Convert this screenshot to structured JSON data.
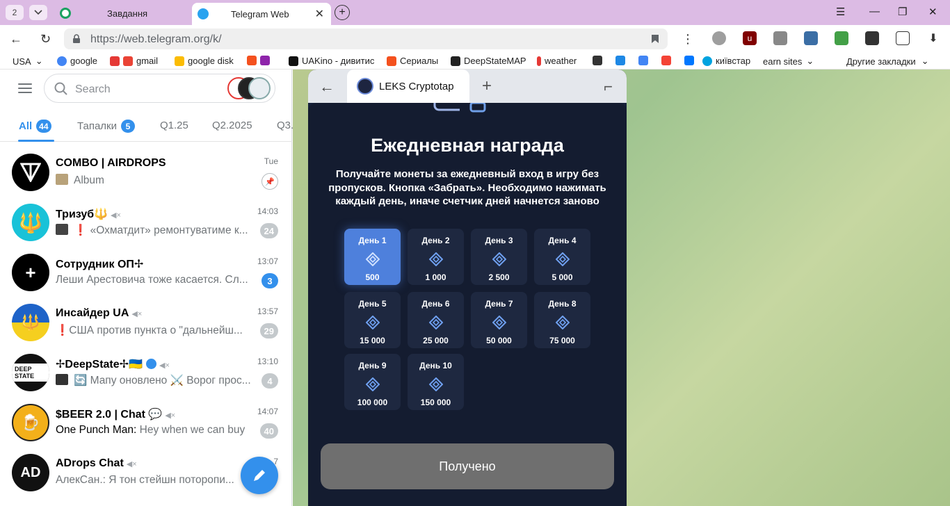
{
  "browser": {
    "tab_count": "2",
    "tabs": [
      {
        "title": "Завдання"
      },
      {
        "title": "Telegram Web"
      }
    ],
    "url": "https://web.telegram.org/k/",
    "bookmarks": [
      "USA",
      "google",
      "gmail",
      "google disk",
      "UAKino - дивитис",
      "Сериалы",
      "DeepStateMAP",
      "weather",
      "київстар",
      "earn sites",
      "Другие закладки"
    ]
  },
  "sidebar": {
    "search_placeholder": "Search",
    "folders": [
      {
        "label": "All",
        "badge": "44"
      },
      {
        "label": "Тапалки",
        "badge": "5"
      },
      {
        "label": "Q1.25",
        "badge": ""
      },
      {
        "label": "Q2.2025",
        "badge": ""
      },
      {
        "label": "Q3.",
        "badge": ""
      }
    ],
    "chats": [
      {
        "name": "COMBO | AIRDROPS",
        "message": "Album",
        "time": "Tue",
        "badge": ""
      },
      {
        "name": "Тризуб🔱",
        "message": "❗ «Охматдит» ремонтуватиме к...",
        "time": "14:03",
        "badge": "24"
      },
      {
        "name": "Сотрудник ОП✢",
        "message": "Леши Арестовича тоже касается. Сл...",
        "time": "13:07",
        "badge": "3"
      },
      {
        "name": "Инсайдер UA",
        "message": "❗США против пункта о \"дальнейш...",
        "time": "13:57",
        "badge": "29"
      },
      {
        "name": "✢DeepState✢🇺🇦",
        "message": "🔄 Мапу оновлено ⚔️ Ворог прос...",
        "time": "13:10",
        "badge": "4"
      },
      {
        "name": "$BEER 2.0 | Chat 💬",
        "message_sender": "One Punch Man:",
        "message": "Hey when we can buy",
        "time": "14:07",
        "badge": "40"
      },
      {
        "name": "ADrops Chat",
        "message": "АлекСан.: Я тон стейшн поторопи...",
        "time": "7",
        "badge": ""
      }
    ]
  },
  "webapp": {
    "tab_title": "LEKS Cryptotap",
    "title": "Ежедневная награда",
    "description": "Получайте монеты за ежедневный вход в игру без пропусков. Кнопка «Забрать». Необходимо нажимать каждый день, иначе счетчик дней начнется заново",
    "days": [
      {
        "label": "День 1",
        "value": "500",
        "active": true
      },
      {
        "label": "День 2",
        "value": "1 000",
        "active": false
      },
      {
        "label": "День 3",
        "value": "2 500",
        "active": false
      },
      {
        "label": "День 4",
        "value": "5 000",
        "active": false
      },
      {
        "label": "День 5",
        "value": "15 000",
        "active": false
      },
      {
        "label": "День 6",
        "value": "25 000",
        "active": false
      },
      {
        "label": "День 7",
        "value": "50 000",
        "active": false
      },
      {
        "label": "День 8",
        "value": "75 000",
        "active": false
      },
      {
        "label": "День 9",
        "value": "100 000",
        "active": false
      },
      {
        "label": "День 10",
        "value": "150 000",
        "active": false
      }
    ],
    "claim_label": "Получено"
  },
  "colors": {
    "accent": "#3390ec",
    "active_day": "#4e80dc",
    "app_bg": "#141c30"
  }
}
